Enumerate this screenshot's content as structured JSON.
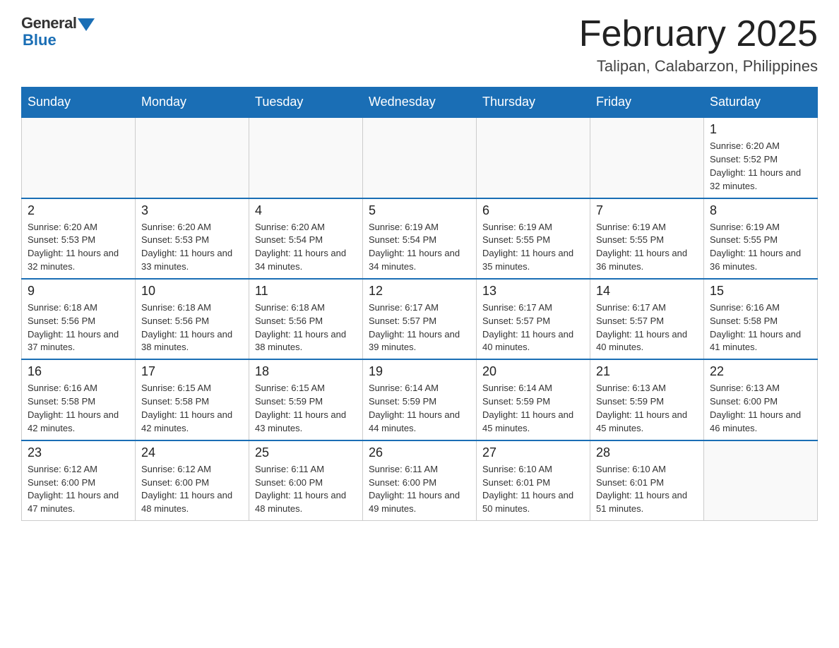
{
  "header": {
    "logo_general": "General",
    "logo_blue": "Blue",
    "month_title": "February 2025",
    "location": "Talipan, Calabarzon, Philippines"
  },
  "days_of_week": [
    "Sunday",
    "Monday",
    "Tuesday",
    "Wednesday",
    "Thursday",
    "Friday",
    "Saturday"
  ],
  "weeks": [
    [
      {
        "day": "",
        "info": ""
      },
      {
        "day": "",
        "info": ""
      },
      {
        "day": "",
        "info": ""
      },
      {
        "day": "",
        "info": ""
      },
      {
        "day": "",
        "info": ""
      },
      {
        "day": "",
        "info": ""
      },
      {
        "day": "1",
        "info": "Sunrise: 6:20 AM\nSunset: 5:52 PM\nDaylight: 11 hours and 32 minutes."
      }
    ],
    [
      {
        "day": "2",
        "info": "Sunrise: 6:20 AM\nSunset: 5:53 PM\nDaylight: 11 hours and 32 minutes."
      },
      {
        "day": "3",
        "info": "Sunrise: 6:20 AM\nSunset: 5:53 PM\nDaylight: 11 hours and 33 minutes."
      },
      {
        "day": "4",
        "info": "Sunrise: 6:20 AM\nSunset: 5:54 PM\nDaylight: 11 hours and 34 minutes."
      },
      {
        "day": "5",
        "info": "Sunrise: 6:19 AM\nSunset: 5:54 PM\nDaylight: 11 hours and 34 minutes."
      },
      {
        "day": "6",
        "info": "Sunrise: 6:19 AM\nSunset: 5:55 PM\nDaylight: 11 hours and 35 minutes."
      },
      {
        "day": "7",
        "info": "Sunrise: 6:19 AM\nSunset: 5:55 PM\nDaylight: 11 hours and 36 minutes."
      },
      {
        "day": "8",
        "info": "Sunrise: 6:19 AM\nSunset: 5:55 PM\nDaylight: 11 hours and 36 minutes."
      }
    ],
    [
      {
        "day": "9",
        "info": "Sunrise: 6:18 AM\nSunset: 5:56 PM\nDaylight: 11 hours and 37 minutes."
      },
      {
        "day": "10",
        "info": "Sunrise: 6:18 AM\nSunset: 5:56 PM\nDaylight: 11 hours and 38 minutes."
      },
      {
        "day": "11",
        "info": "Sunrise: 6:18 AM\nSunset: 5:56 PM\nDaylight: 11 hours and 38 minutes."
      },
      {
        "day": "12",
        "info": "Sunrise: 6:17 AM\nSunset: 5:57 PM\nDaylight: 11 hours and 39 minutes."
      },
      {
        "day": "13",
        "info": "Sunrise: 6:17 AM\nSunset: 5:57 PM\nDaylight: 11 hours and 40 minutes."
      },
      {
        "day": "14",
        "info": "Sunrise: 6:17 AM\nSunset: 5:57 PM\nDaylight: 11 hours and 40 minutes."
      },
      {
        "day": "15",
        "info": "Sunrise: 6:16 AM\nSunset: 5:58 PM\nDaylight: 11 hours and 41 minutes."
      }
    ],
    [
      {
        "day": "16",
        "info": "Sunrise: 6:16 AM\nSunset: 5:58 PM\nDaylight: 11 hours and 42 minutes."
      },
      {
        "day": "17",
        "info": "Sunrise: 6:15 AM\nSunset: 5:58 PM\nDaylight: 11 hours and 42 minutes."
      },
      {
        "day": "18",
        "info": "Sunrise: 6:15 AM\nSunset: 5:59 PM\nDaylight: 11 hours and 43 minutes."
      },
      {
        "day": "19",
        "info": "Sunrise: 6:14 AM\nSunset: 5:59 PM\nDaylight: 11 hours and 44 minutes."
      },
      {
        "day": "20",
        "info": "Sunrise: 6:14 AM\nSunset: 5:59 PM\nDaylight: 11 hours and 45 minutes."
      },
      {
        "day": "21",
        "info": "Sunrise: 6:13 AM\nSunset: 5:59 PM\nDaylight: 11 hours and 45 minutes."
      },
      {
        "day": "22",
        "info": "Sunrise: 6:13 AM\nSunset: 6:00 PM\nDaylight: 11 hours and 46 minutes."
      }
    ],
    [
      {
        "day": "23",
        "info": "Sunrise: 6:12 AM\nSunset: 6:00 PM\nDaylight: 11 hours and 47 minutes."
      },
      {
        "day": "24",
        "info": "Sunrise: 6:12 AM\nSunset: 6:00 PM\nDaylight: 11 hours and 48 minutes."
      },
      {
        "day": "25",
        "info": "Sunrise: 6:11 AM\nSunset: 6:00 PM\nDaylight: 11 hours and 48 minutes."
      },
      {
        "day": "26",
        "info": "Sunrise: 6:11 AM\nSunset: 6:00 PM\nDaylight: 11 hours and 49 minutes."
      },
      {
        "day": "27",
        "info": "Sunrise: 6:10 AM\nSunset: 6:01 PM\nDaylight: 11 hours and 50 minutes."
      },
      {
        "day": "28",
        "info": "Sunrise: 6:10 AM\nSunset: 6:01 PM\nDaylight: 11 hours and 51 minutes."
      },
      {
        "day": "",
        "info": ""
      }
    ]
  ]
}
